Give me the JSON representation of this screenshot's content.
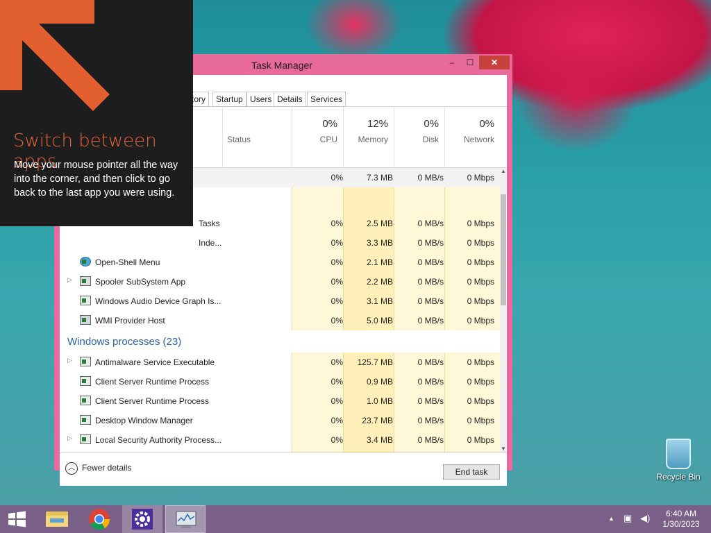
{
  "window": {
    "title": "Task Manager",
    "min_label": "‒",
    "max_label": "☐",
    "close_label": "✕"
  },
  "tabs": [
    "tory",
    "Startup",
    "Users",
    "Details",
    "Services"
  ],
  "columns": {
    "status": {
      "name": "Status"
    },
    "cpu": {
      "pct": "0%",
      "name": "CPU"
    },
    "memory": {
      "pct": "12%",
      "name": "Memory"
    },
    "disk": {
      "pct": "0%",
      "name": "Disk"
    },
    "network": {
      "pct": "0%",
      "name": "Network"
    }
  },
  "rows": {
    "r0": {
      "name": "",
      "cpu": "0%",
      "mem": "7.3 MB",
      "disk": "0 MB/s",
      "net": "0 Mbps"
    },
    "r1": {
      "name": "Tasks",
      "cpu": "0%",
      "mem": "2.5 MB",
      "disk": "0 MB/s",
      "net": "0 Mbps"
    },
    "r2": {
      "name": "Inde...",
      "cpu": "0%",
      "mem": "3.3 MB",
      "disk": "0 MB/s",
      "net": "0 Mbps"
    },
    "r3": {
      "name": "Open-Shell Menu",
      "cpu": "0%",
      "mem": "2.1 MB",
      "disk": "0 MB/s",
      "net": "0 Mbps"
    },
    "r4": {
      "name": "Spooler SubSystem App",
      "cpu": "0%",
      "mem": "2.2 MB",
      "disk": "0 MB/s",
      "net": "0 Mbps"
    },
    "r5": {
      "name": "Windows Audio Device Graph Is...",
      "cpu": "0%",
      "mem": "3.1 MB",
      "disk": "0 MB/s",
      "net": "0 Mbps"
    },
    "r6": {
      "name": "WMI Provider Host",
      "cpu": "0%",
      "mem": "5.0 MB",
      "disk": "0 MB/s",
      "net": "0 Mbps"
    },
    "group": "Windows processes (23)",
    "r7": {
      "name": "Antimalware Service Executable",
      "cpu": "0%",
      "mem": "125.7 MB",
      "disk": "0 MB/s",
      "net": "0 Mbps"
    },
    "r8": {
      "name": "Client Server Runtime Process",
      "cpu": "0%",
      "mem": "0.9 MB",
      "disk": "0 MB/s",
      "net": "0 Mbps"
    },
    "r9": {
      "name": "Client Server Runtime Process",
      "cpu": "0%",
      "mem": "1.0 MB",
      "disk": "0 MB/s",
      "net": "0 Mbps"
    },
    "r10": {
      "name": "Desktop Window Manager",
      "cpu": "0%",
      "mem": "23.7 MB",
      "disk": "0 MB/s",
      "net": "0 Mbps"
    },
    "r11": {
      "name": "Local Security Authority Process...",
      "cpu": "0%",
      "mem": "3.4 MB",
      "disk": "0 MB/s",
      "net": "0 Mbps"
    }
  },
  "footer": {
    "fewer_details": "Fewer details",
    "end_task": "End task"
  },
  "hint": {
    "title": "Switch between apps",
    "body": "Move your mouse pointer all the way into the corner, and then click to go back to the last app you were using.",
    "accent": "#e8643a"
  },
  "desktop": {
    "recycle_bin": "Recycle Bin"
  },
  "taskbar": {
    "time": "6:40 AM",
    "date": "1/30/2023",
    "icons": [
      "windows-start-icon",
      "file-explorer-icon",
      "chrome-icon",
      "settings-icon",
      "task-manager-icon"
    ]
  }
}
